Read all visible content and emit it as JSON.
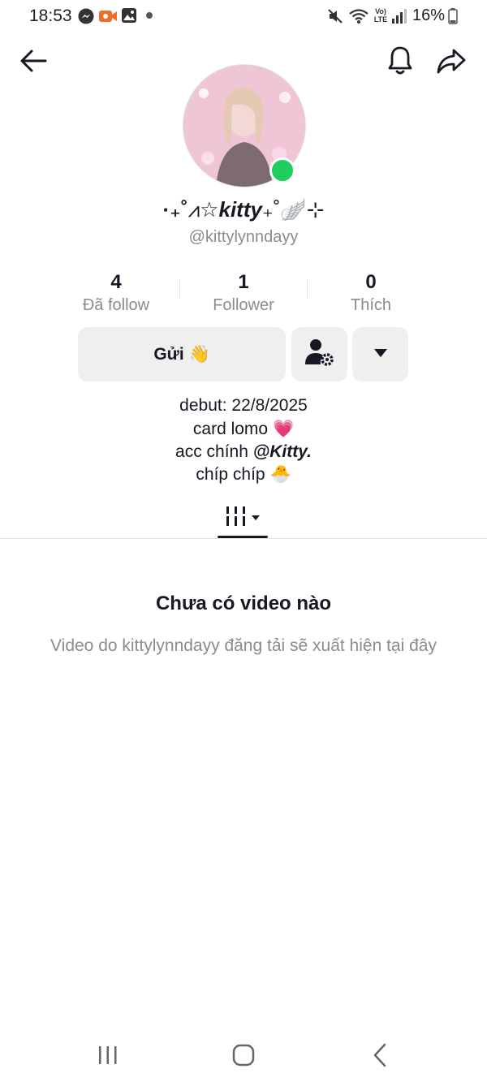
{
  "status_bar": {
    "time": "18:53",
    "left_icons": [
      "messenger-icon",
      "video-call-icon",
      "gallery-icon",
      "dot-icon"
    ],
    "right_icons": [
      "mute-icon",
      "wifi-icon",
      "volte-icon",
      "signal-icon",
      "battery-icon"
    ],
    "volte_top": "Vo)",
    "volte_bottom": "LTE",
    "battery": "16%"
  },
  "nav": {
    "back_icon": "arrow-left-icon",
    "notification_icon": "bell-icon",
    "share_icon": "share-arrow-icon"
  },
  "profile": {
    "display_name_prefix": "·₊˚",
    "display_name_sym": "⩘☆",
    "display_name_main": "kitty",
    "display_name_suffix": "₊˚🪽⊹",
    "username": "@kittylynndayy",
    "online": true,
    "online_color": "#1fce5f"
  },
  "stats": [
    {
      "value": "4",
      "label": "Đã follow"
    },
    {
      "value": "1",
      "label": "Follower"
    },
    {
      "value": "0",
      "label": "Thích"
    }
  ],
  "actions": {
    "send_label": "Gửi 👋",
    "add_friend_icon": "person-settings-icon",
    "more_icon": "caret-down-icon"
  },
  "bio": {
    "line1": "debut: 22/8/2025",
    "line2": "card lomo 💗",
    "line3_text": "acc chính ",
    "line3_mention": "@Kitty.",
    "line4": "chíp chíp 🐣"
  },
  "tabs": {
    "active_icon": "grid-columns-icon",
    "dropdown_icon": "caret-down-icon"
  },
  "empty_state": {
    "title": "Chưa có video nào",
    "description": "Video do kittylynndayy đăng tải sẽ xuất hiện tại đây"
  },
  "system_nav": {
    "recents_icon": "recents-icon",
    "home_icon": "home-icon",
    "back_icon": "back-chevron-icon"
  },
  "colors": {
    "text_primary": "#161823",
    "text_secondary": "#8a8b91",
    "button_bg": "#efeff0"
  }
}
